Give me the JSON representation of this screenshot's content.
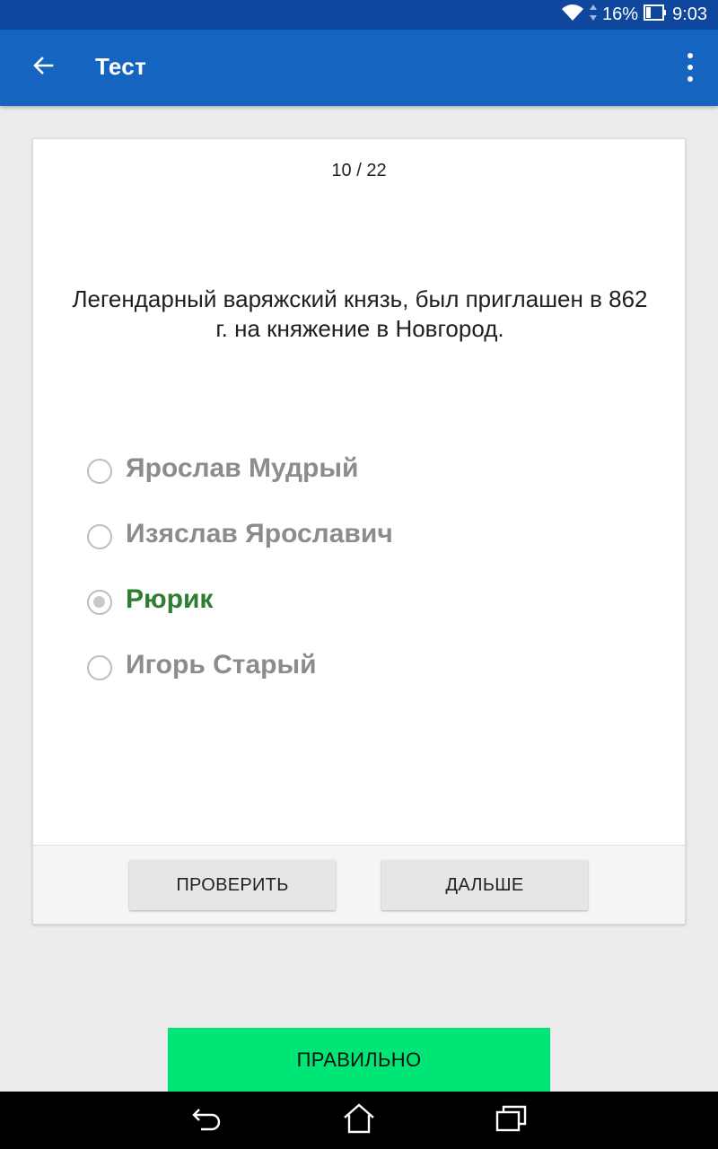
{
  "status_bar": {
    "battery": "16%",
    "time": "9:03"
  },
  "app_bar": {
    "title": "Тест",
    "back_icon": "arrow-left-icon",
    "menu_icon": "more-vertical-icon"
  },
  "quiz": {
    "counter": "10 / 22",
    "question": "Легендарный варяжский князь, был приглашен в 862 г. на княжение в Новгород.",
    "options": [
      {
        "label": "Ярослав Мудрый",
        "selected": false,
        "correct": false
      },
      {
        "label": "Изяслав Ярославич",
        "selected": false,
        "correct": false
      },
      {
        "label": "Рюрик",
        "selected": true,
        "correct": true
      },
      {
        "label": "Игорь Старый",
        "selected": false,
        "correct": false
      }
    ],
    "check_label": "ПРОВЕРИТЬ",
    "next_label": "ДАЛЬШЕ"
  },
  "result": {
    "label": "ПРАВИЛЬНО"
  },
  "colors": {
    "status_bar": "#0f479f",
    "app_bar": "#1565c0",
    "correct_text": "#2e7d32",
    "result_banner": "#00e676"
  }
}
